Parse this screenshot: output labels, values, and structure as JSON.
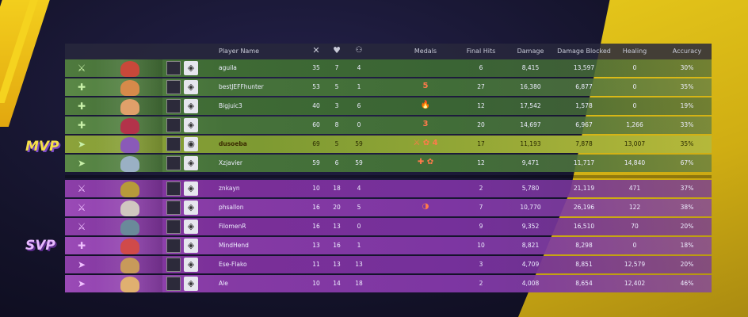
{
  "labels": {
    "mvp": "MVP",
    "svp": "SVP"
  },
  "headers": {
    "player_name": "Player Name",
    "medals": "Medals",
    "final_hits": "Final Hits",
    "damage": "Damage",
    "damage_blocked": "Damage Blocked",
    "healing": "Healing",
    "accuracy": "Accuracy",
    "kills_icon": "swords-icon",
    "deaths_icon": "broken-heart-icon",
    "assists_icon": "handshake-icon"
  },
  "rows": [
    {
      "team": "green",
      "name": "aguila",
      "k": "35",
      "d": "7",
      "a": "4",
      "medals": "",
      "fh": "6",
      "dmg": "8,415",
      "blocked": "13,597",
      "heal": "0",
      "acc": "30%",
      "role": "vanguard-icon"
    },
    {
      "team": "green",
      "name": "bestJEFFhunter",
      "k": "53",
      "d": "5",
      "a": "1",
      "medals": "5",
      "fh": "27",
      "dmg": "16,380",
      "blocked": "6,877",
      "heal": "0",
      "acc": "35%",
      "role": "strategist-icon"
    },
    {
      "team": "green",
      "name": "Bigjuic3",
      "k": "40",
      "d": "3",
      "a": "6",
      "medals": "🔥",
      "fh": "12",
      "dmg": "17,542",
      "blocked": "1,578",
      "heal": "0",
      "acc": "19%",
      "role": "strategist-icon"
    },
    {
      "team": "green",
      "name": "",
      "k": "60",
      "d": "8",
      "a": "0",
      "medals": "3",
      "fh": "20",
      "dmg": "14,697",
      "blocked": "6,967",
      "heal": "1,266",
      "acc": "33%",
      "role": "strategist-icon"
    },
    {
      "team": "mvp",
      "name": "dusoeba",
      "k": "69",
      "d": "5",
      "a": "59",
      "medals": "⚔ ✿ 4",
      "fh": "17",
      "dmg": "11,193",
      "blocked": "7,878",
      "heal": "13,007",
      "acc": "35%",
      "role": "duelist-icon"
    },
    {
      "team": "green",
      "name": "Xzjavier",
      "k": "59",
      "d": "6",
      "a": "59",
      "medals": "✚ ✿",
      "fh": "12",
      "dmg": "9,471",
      "blocked": "11,717",
      "heal": "14,840",
      "acc": "67%",
      "role": "duelist-icon"
    },
    {
      "team": "purple",
      "name": "znkayn",
      "k": "10",
      "d": "18",
      "a": "4",
      "medals": "",
      "fh": "2",
      "dmg": "5,780",
      "blocked": "21,119",
      "heal": "471",
      "acc": "37%",
      "role": "vanguard-icon"
    },
    {
      "team": "purple",
      "name": "phsallon",
      "k": "16",
      "d": "20",
      "a": "5",
      "medals": "◑",
      "fh": "7",
      "dmg": "10,770",
      "blocked": "26,196",
      "heal": "122",
      "acc": "38%",
      "role": "vanguard-icon"
    },
    {
      "team": "purple",
      "name": "FilomenR",
      "k": "16",
      "d": "13",
      "a": "0",
      "medals": "",
      "fh": "9",
      "dmg": "9,352",
      "blocked": "16,510",
      "heal": "70",
      "acc": "20%",
      "role": "vanguard-icon"
    },
    {
      "team": "purple",
      "name": "MindHend",
      "k": "13",
      "d": "16",
      "a": "1",
      "medals": "",
      "fh": "10",
      "dmg": "8,821",
      "blocked": "8,298",
      "heal": "0",
      "acc": "18%",
      "role": "strategist-icon"
    },
    {
      "team": "purple",
      "name": "Ese-Flako",
      "k": "11",
      "d": "13",
      "a": "13",
      "medals": "",
      "fh": "3",
      "dmg": "4,709",
      "blocked": "8,851",
      "heal": "12,579",
      "acc": "20%",
      "role": "duelist-icon"
    },
    {
      "team": "purple",
      "name": "Ale",
      "k": "10",
      "d": "14",
      "a": "18",
      "medals": "",
      "fh": "2",
      "dmg": "4,008",
      "blocked": "8,654",
      "heal": "12,402",
      "acc": "46%",
      "role": "duelist-icon"
    }
  ],
  "colors": {
    "team_green": "#3e6a34",
    "team_purple": "#7a2f98",
    "mvp_row": "#91a636",
    "accent_yellow": "#f2d21a"
  }
}
